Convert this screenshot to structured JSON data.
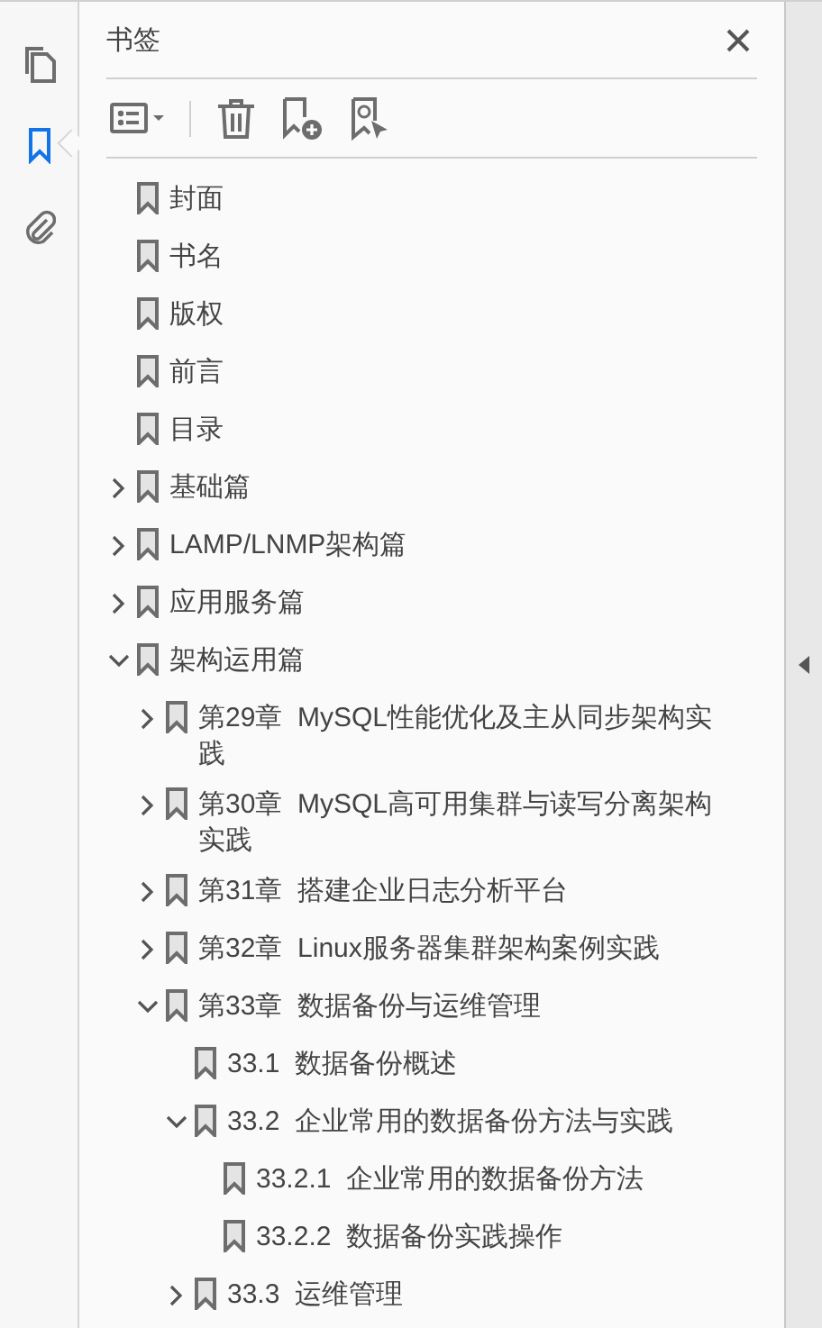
{
  "rail": [
    {
      "kind": "pages",
      "selected": false
    },
    {
      "kind": "bookmarks",
      "selected": true
    },
    {
      "kind": "attachments",
      "selected": false
    }
  ],
  "panel": {
    "title": "书签",
    "toolbar": [
      {
        "kind": "options"
      },
      {
        "kind": "delete"
      },
      {
        "kind": "add"
      },
      {
        "kind": "select"
      }
    ],
    "items": [
      {
        "label": "封面"
      },
      {
        "label": "书名"
      },
      {
        "label": "版权"
      },
      {
        "label": "前言"
      },
      {
        "label": "目录"
      },
      {
        "label": "基础篇",
        "expanded": false
      },
      {
        "label": "LAMP/LNMP架构篇",
        "expanded": false
      },
      {
        "label": "应用服务篇",
        "expanded": false
      },
      {
        "label": "架构运用篇",
        "expanded": true,
        "children": [
          {
            "label": "第29章  MySQL性能优化及主从同步架构实践",
            "expanded": false
          },
          {
            "label": "第30章  MySQL高可用集群与读写分离架构实践",
            "expanded": false
          },
          {
            "label": "第31章  搭建企业日志分析平台",
            "expanded": false
          },
          {
            "label": "第32章  Linux服务器集群架构案例实践",
            "expanded": false
          },
          {
            "label": "第33章  数据备份与运维管理",
            "expanded": true,
            "children": [
              {
                "label": "33.1  数据备份概述"
              },
              {
                "label": "33.2  企业常用的数据备份方法与实践",
                "expanded": true,
                "children": [
                  {
                    "label": "33.2.1  企业常用的数据备份方法"
                  },
                  {
                    "label": "33.2.2  数据备份实践操作"
                  }
                ]
              },
              {
                "label": "33.3  运维管理",
                "expanded": false
              }
            ]
          }
        ]
      }
    ]
  }
}
